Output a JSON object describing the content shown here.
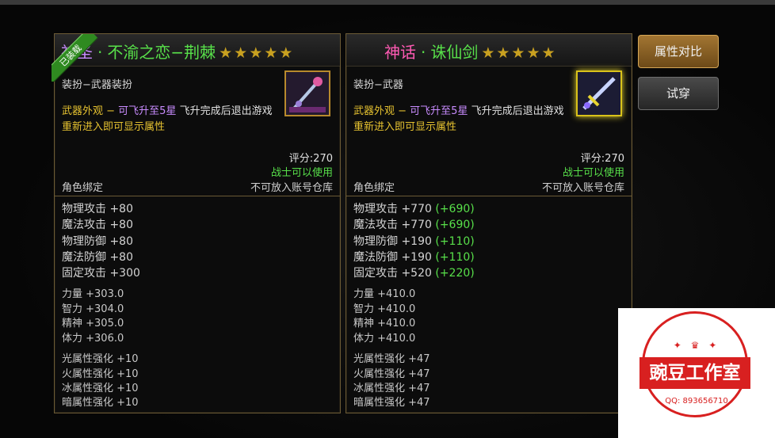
{
  "left_item": {
    "ribbon": "已装载",
    "grade": "神圣",
    "dot": "·",
    "name": "不渝之恋−荆棘",
    "stars": "★★★★★",
    "type": "装扮−武器装扮",
    "desc_line1_a": "武器外观 − ",
    "desc_line1_b": "可飞升至5星",
    "desc_line1_c": " 飞升完成后退出游戏",
    "desc_line2": "重新进入即可显示属性",
    "score": "评分:270",
    "job": "战士可以使用",
    "bind": "角色绑定",
    "store": "不可放入账号仓库",
    "main_stats": [
      {
        "label": "物理攻击 +80",
        "diff": ""
      },
      {
        "label": "魔法攻击 +80",
        "diff": ""
      },
      {
        "label": "物理防御 +80",
        "diff": ""
      },
      {
        "label": "魔法防御 +80",
        "diff": ""
      },
      {
        "label": "固定攻击 +300",
        "diff": ""
      }
    ],
    "attr_stats": [
      "力量 +303.0",
      "智力 +304.0",
      "精神 +305.0",
      "体力 +306.0"
    ],
    "elem_stats": [
      "光属性强化 +10",
      "火属性强化 +10",
      "冰属性强化 +10",
      "暗属性强化 +10"
    ]
  },
  "right_item": {
    "grade": "神话",
    "dot": "·",
    "name": "诛仙剑",
    "stars": "★★★★★",
    "type": "装扮−武器",
    "desc_line1_a": "武器外观 − ",
    "desc_line1_b": "可飞升至5星",
    "desc_line1_c": " 飞升完成后退出游戏",
    "desc_line2": "重新进入即可显示属性",
    "score": "评分:270",
    "job": "战士可以使用",
    "bind": "角色绑定",
    "store": "不可放入账号仓库",
    "main_stats": [
      {
        "label": "物理攻击 +770",
        "diff": "(+690)"
      },
      {
        "label": "魔法攻击 +770",
        "diff": "(+690)"
      },
      {
        "label": "物理防御 +190",
        "diff": "(+110)"
      },
      {
        "label": "魔法防御 +190",
        "diff": "(+110)"
      },
      {
        "label": "固定攻击 +520",
        "diff": "(+220)"
      }
    ],
    "attr_stats": [
      "力量 +410.0",
      "智力 +410.0",
      "精神 +410.0",
      "体力 +410.0"
    ],
    "elem_stats": [
      "光属性强化 +47",
      "火属性强化 +47",
      "冰属性强化 +47",
      "暗属性强化 +47"
    ]
  },
  "buttons": {
    "compare": "属性对比",
    "try_on": "试穿"
  },
  "watermark": {
    "name": "豌豆工作室",
    "qq": "QQ: 893656710"
  }
}
